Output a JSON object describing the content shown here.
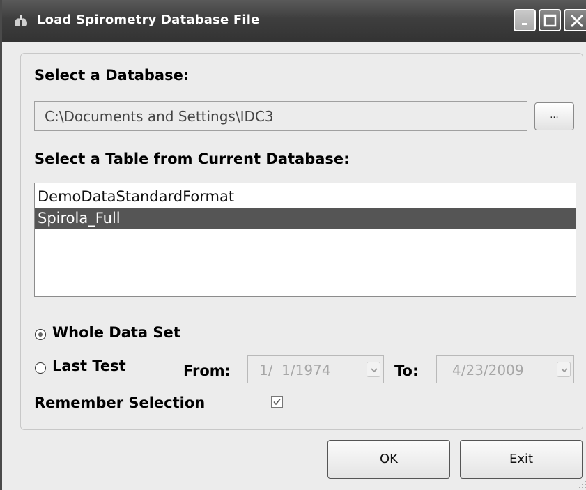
{
  "window": {
    "title": "Load Spirometry Database File"
  },
  "database": {
    "label": "Select a Database:",
    "path": "C:\\Documents and Settings\\IDC3",
    "browse_label": "..."
  },
  "table": {
    "label": "Select a Table from Current Database:",
    "items": [
      {
        "label": "DemoDataStandardFormat",
        "selected": false
      },
      {
        "label": "Spirola_Full",
        "selected": true
      }
    ]
  },
  "range": {
    "whole_label": "Whole Data Set",
    "whole_selected": true,
    "last_label": "Last Test",
    "from_label": "From:",
    "from_value": "1/  1/1974",
    "to_label": "To:",
    "to_value": "4/23/2009",
    "remember_label": "Remember Selection",
    "remember_checked": true
  },
  "buttons": {
    "ok": "OK",
    "exit": "Exit"
  },
  "icons": {
    "app": "lungs-icon",
    "minimize": "minimize-icon",
    "maximize": "maximize-icon",
    "close": "close-icon"
  }
}
